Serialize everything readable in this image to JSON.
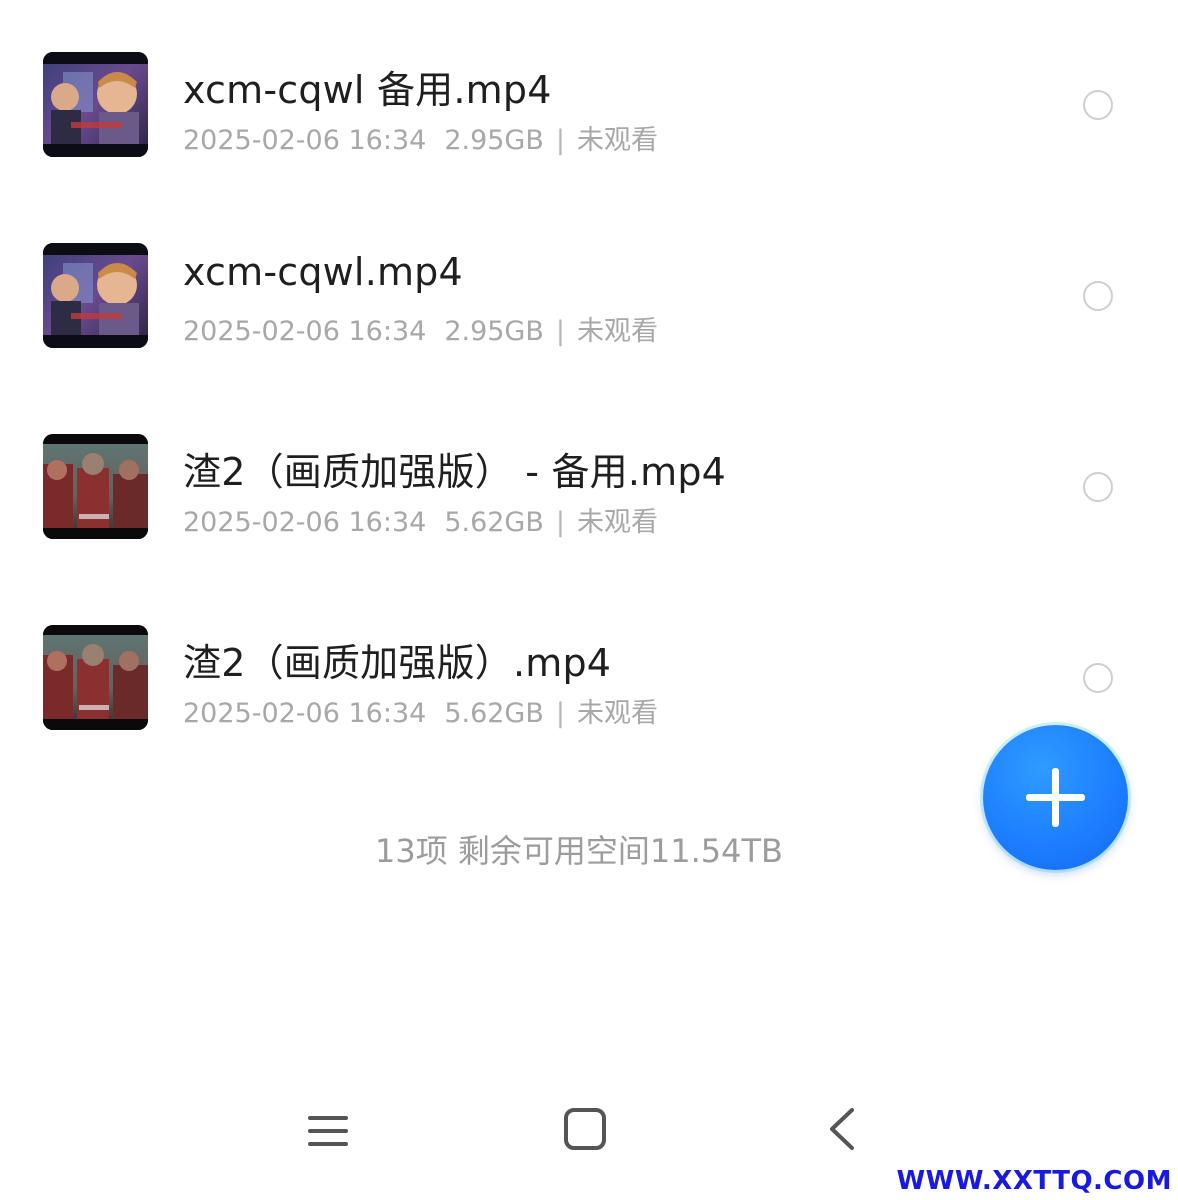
{
  "files": [
    {
      "name": "xcm-cqwl 备用.mp4",
      "datetime": "2025-02-06 16:34",
      "size": "2.95GB",
      "status": "未观看",
      "thumbnail": "animated-characters-thumbnail"
    },
    {
      "name": "xcm-cqwl.mp4",
      "datetime": "2025-02-06 16:34",
      "size": "2.95GB",
      "status": "未观看",
      "thumbnail": "animated-characters-thumbnail"
    },
    {
      "name": "渣2（画质加强版） - 备用.mp4",
      "datetime": "2025-02-06 16:34",
      "size": "5.62GB",
      "status": "未观看",
      "thumbnail": "soldiers-scene-thumbnail"
    },
    {
      "name": "渣2（画质加强版）.mp4",
      "datetime": "2025-02-06 16:34",
      "size": "5.62GB",
      "status": "未观看",
      "thumbnail": "soldiers-scene-thumbnail"
    }
  ],
  "summary": "13项 剩余可用空间11.54TB",
  "fab": {
    "icon": "plus-icon",
    "color": "#1d7fff"
  },
  "nav": {
    "menu_icon": "menu-icon",
    "home_icon": "home-square-icon",
    "back_icon": "back-chevron-icon"
  },
  "watermark": "WWW.XXTTQ.COM",
  "colors": {
    "primary_text": "#1f1f1f",
    "secondary_text": "#a8a8a8",
    "accent": "#1d7fff"
  }
}
